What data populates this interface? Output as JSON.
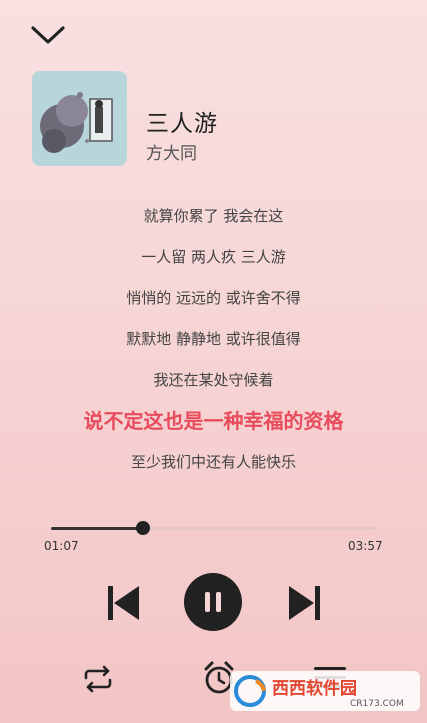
{
  "song": {
    "title": "三人游",
    "artist": "方大同"
  },
  "lyrics": [
    "就算你累了 我会在这",
    "一人留 两人疚 三人游",
    "悄悄的 远远的 或许舍不得",
    "默默地 静静地 或许很值得",
    "我还在某处守候着",
    "说不定这也是一种幸福的资格",
    "至少我们中还有人能快乐"
  ],
  "current_lyric_index": 5,
  "playback": {
    "elapsed": "01:07",
    "total": "03:57",
    "progress": 0.283
  },
  "colors": {
    "accent": "#e84c5c",
    "controls": "#222222"
  },
  "icons": {
    "collapse": "chevron-down-icon",
    "previous": "skip-previous-icon",
    "play_pause": "pause-icon",
    "next": "skip-next-icon",
    "repeat": "repeat-icon",
    "alarm": "alarm-clock-icon",
    "playlist": "playlist-icon"
  },
  "watermark": {
    "brand": "西西软件园",
    "url": "CR173.COM"
  }
}
